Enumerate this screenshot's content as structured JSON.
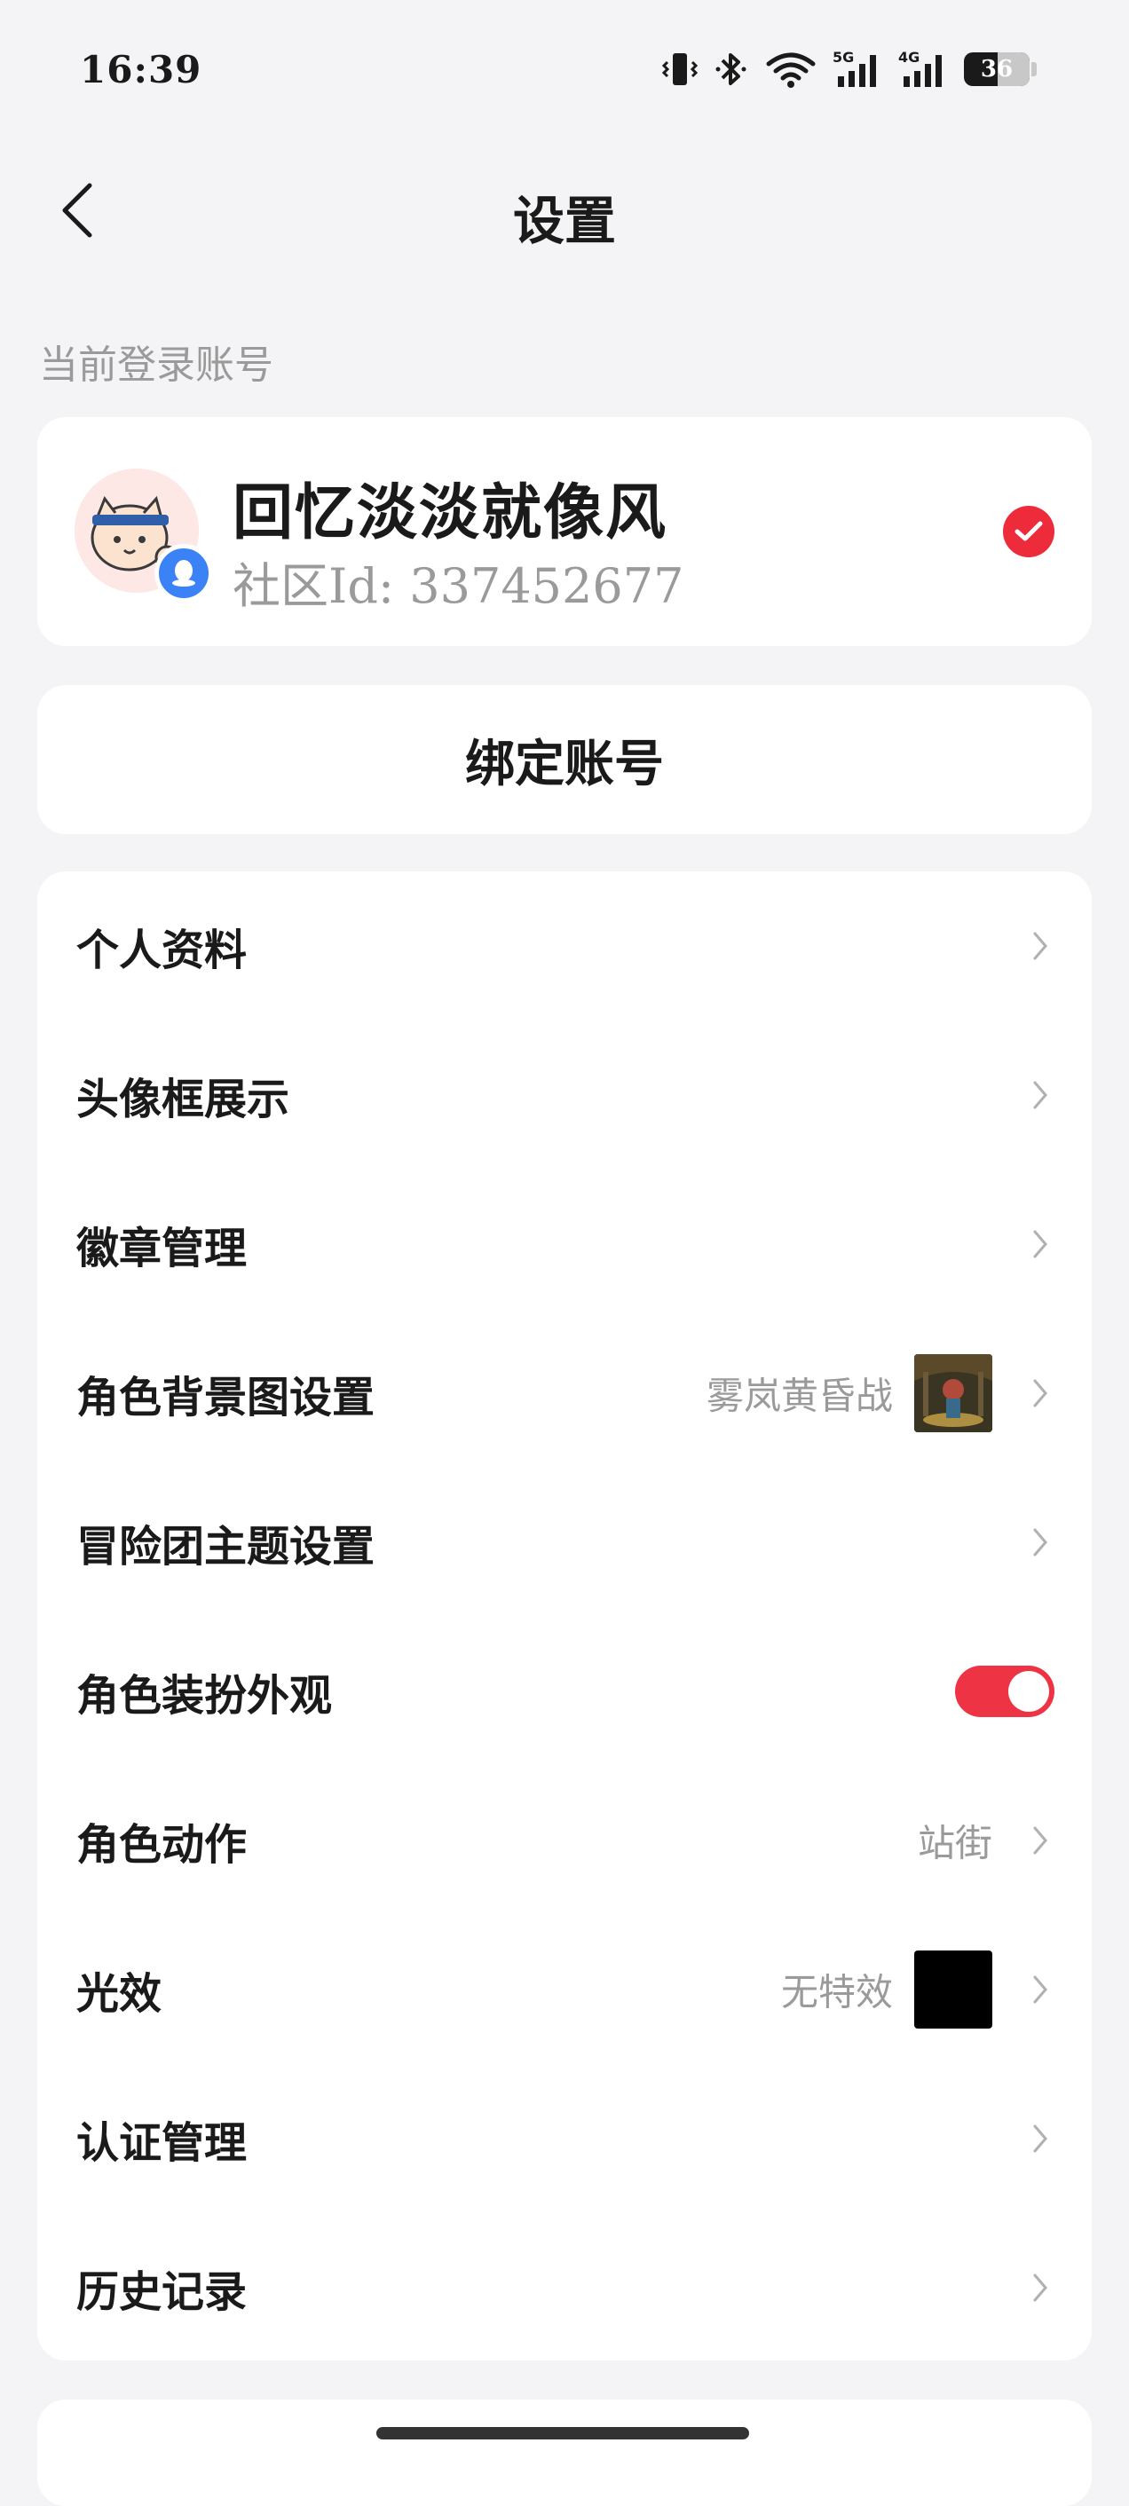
{
  "status_bar": {
    "time": "16:39",
    "battery": "36",
    "signal_5g": "5G",
    "signal_4g": "4G"
  },
  "nav": {
    "title": "设置"
  },
  "account_section": {
    "label": "当前登录账号",
    "name": "回忆淡淡就像风",
    "community_id": "社区Id: 337452677"
  },
  "bind_button": {
    "label": "绑定账号"
  },
  "menu": {
    "items": [
      {
        "label": "个人资料",
        "value": ""
      },
      {
        "label": "头像框展示",
        "value": ""
      },
      {
        "label": "徽章管理",
        "value": ""
      },
      {
        "label": "角色背景图设置",
        "value": "雾岚黄昏战"
      },
      {
        "label": "冒险团主题设置",
        "value": ""
      },
      {
        "label": "角色装扮外观",
        "value": "",
        "toggle_on": true
      },
      {
        "label": "角色动作",
        "value": "站街"
      },
      {
        "label": "光效",
        "value": "无特效"
      },
      {
        "label": "认证管理",
        "value": ""
      },
      {
        "label": "历史记录",
        "value": ""
      }
    ]
  },
  "colors": {
    "accent": "#ee2b3b",
    "background": "#f4f4f6",
    "secondary_text": "#9a9a9a"
  },
  "icons": [
    "back-arrow-icon",
    "chevron-right-icon",
    "check-circle-icon",
    "qq-badge-icon",
    "vibrate-icon",
    "bluetooth-icon",
    "wifi-icon",
    "signal-icon",
    "battery-icon"
  ]
}
